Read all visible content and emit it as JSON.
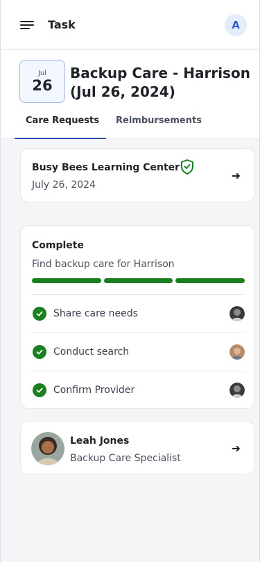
{
  "topbar": {
    "title": "Task",
    "avatar_initial": "A"
  },
  "header": {
    "date_month": "Jul",
    "date_day": "26",
    "title": "Backup Care - Harrison (Jul 26, 2024)"
  },
  "tabs": [
    {
      "label": "Care Requests",
      "active": true
    },
    {
      "label": "Reimbursements",
      "active": false
    }
  ],
  "provider": {
    "name": "Busy Bees Learning Center",
    "date": "July 26, 2024",
    "verified_icon": "shield-check-icon"
  },
  "status": {
    "title": "Complete",
    "description": "Find backup care for Harrison",
    "progress_segments_complete": 3,
    "progress_segments_total": 3,
    "steps": [
      {
        "label": "Share care needs"
      },
      {
        "label": "Conduct search"
      },
      {
        "label": "Confirm Provider"
      }
    ]
  },
  "specialist": {
    "name": "Leah Jones",
    "role": "Backup Care Specialist"
  },
  "colors": {
    "accent": "#2b4fa8",
    "success": "#1a7f1e",
    "avatar_bg": "#e5ecfb"
  }
}
